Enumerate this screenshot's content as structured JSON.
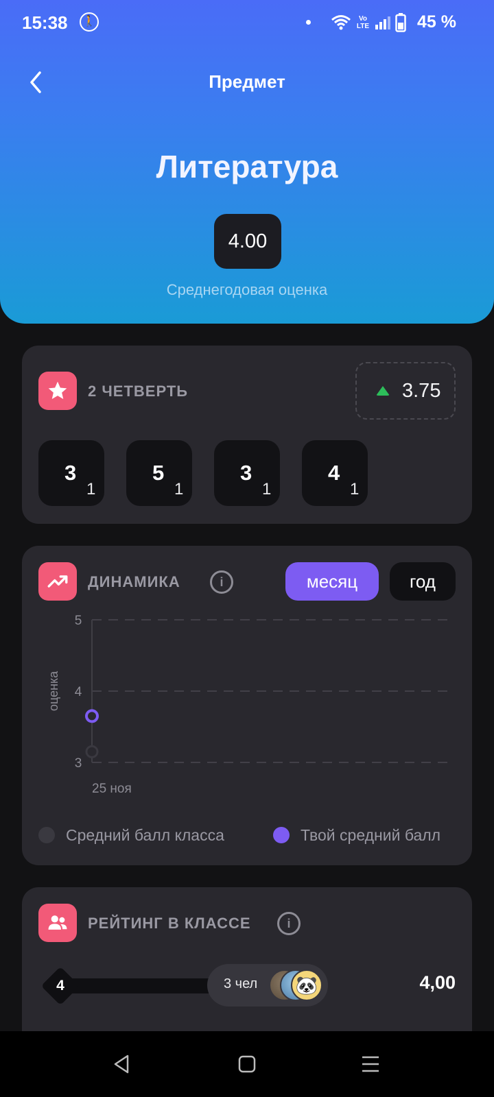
{
  "status_bar": {
    "time": "15:38",
    "battery_percent": "45 %",
    "volte_top": "Vo",
    "volte_bottom": "LTE"
  },
  "header": {
    "title": "Предмет",
    "subject": "Литература",
    "average": "4.00",
    "average_label": "Среднегодовая оценка"
  },
  "quarter": {
    "title": "2 ЧЕТВЕРТЬ",
    "score": "3.75",
    "trend_color": "#2dbe5a",
    "grades": [
      {
        "grade": "3",
        "weight": "1"
      },
      {
        "grade": "5",
        "weight": "1"
      },
      {
        "grade": "3",
        "weight": "1"
      },
      {
        "grade": "4",
        "weight": "1"
      }
    ]
  },
  "dynamics": {
    "title": "ДИНАМИКА",
    "toggle_month": "месяц",
    "toggle_year": "год",
    "active_period": "месяц",
    "legend_class": "Средний балл класса",
    "legend_you": "Твой средний балл"
  },
  "chart_data": {
    "type": "line",
    "ylabel": "оценка",
    "ylim": [
      3,
      5
    ],
    "yticks": [
      "5",
      "4",
      "3"
    ],
    "x": [
      "25 ноя"
    ],
    "grid": true,
    "series": [
      {
        "name": "Твой средний балл",
        "values": [
          3.65
        ],
        "color": "#7d5cf2"
      },
      {
        "name": "Средний балл класса",
        "values": [
          3.15
        ],
        "color": "#3a3940"
      }
    ]
  },
  "rating": {
    "title": "РЕЙТИНГ В КЛАССЕ",
    "place": "4",
    "count": "3 чел",
    "value": "4,00"
  },
  "colors": {
    "accent": "#7d5cf2",
    "card_icon": "#f25a78",
    "card_bg": "#29282e",
    "page_bg": "#121214"
  }
}
